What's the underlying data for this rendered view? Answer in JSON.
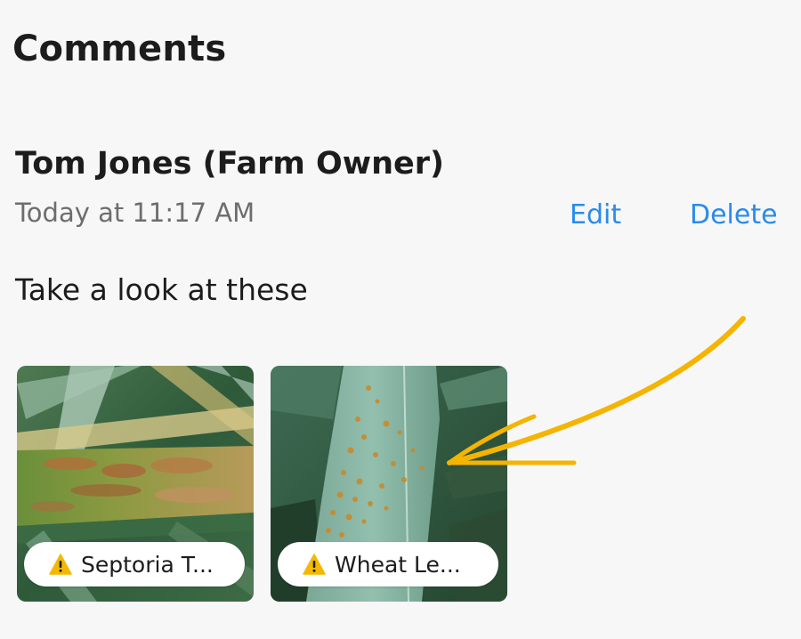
{
  "comments": {
    "title": "Comments",
    "items": [
      {
        "author": "Tom Jones (Farm Owner)",
        "timestamp": "Today at 11:17 AM",
        "edit_label": "Edit",
        "delete_label": "Delete",
        "text": "Take a look at these",
        "attachments": [
          {
            "label": "Septoria T...",
            "icon": "warning-icon"
          },
          {
            "label": "Wheat Le...",
            "icon": "warning-icon"
          }
        ]
      }
    ]
  },
  "colors": {
    "background": "#f7f7f7",
    "link": "#2a8bea",
    "muted_text": "#6d6d6d",
    "warning": "#f5b800",
    "annotation_arrow": "#f4b400"
  }
}
